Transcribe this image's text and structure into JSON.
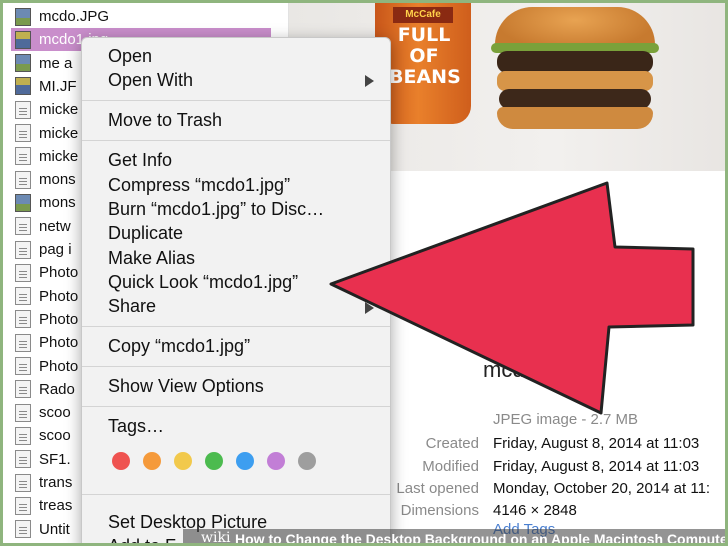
{
  "files": [
    {
      "name": "mcdo.JPG",
      "icon": "image-file-icon"
    },
    {
      "name": "mcdo1.jpg",
      "icon": "image-file-icon",
      "selected": true
    },
    {
      "name": "me a",
      "icon": "image-file-icon"
    },
    {
      "name": "MI.JF",
      "icon": "image-file-icon"
    },
    {
      "name": "micke",
      "icon": "document-icon"
    },
    {
      "name": "micke",
      "icon": "document-icon"
    },
    {
      "name": "micke",
      "icon": "document-icon"
    },
    {
      "name": "mons",
      "icon": "document-icon"
    },
    {
      "name": "mons",
      "icon": "image-file-icon"
    },
    {
      "name": "netw",
      "icon": "document-icon"
    },
    {
      "name": "pag i",
      "icon": "document-icon"
    },
    {
      "name": "Photo",
      "icon": "document-icon"
    },
    {
      "name": "Photo",
      "icon": "document-icon"
    },
    {
      "name": "Photo",
      "icon": "document-icon"
    },
    {
      "name": "Photo",
      "icon": "document-icon"
    },
    {
      "name": "Photo",
      "icon": "document-icon"
    },
    {
      "name": "Rado",
      "icon": "document-icon"
    },
    {
      "name": "scoo",
      "icon": "document-icon"
    },
    {
      "name": "scoo",
      "icon": "document-icon"
    },
    {
      "name": "SF1.",
      "icon": "document-icon"
    },
    {
      "name": "trans",
      "icon": "document-icon"
    },
    {
      "name": "treas",
      "icon": "document-icon"
    },
    {
      "name": "Untit",
      "icon": "document-icon"
    }
  ],
  "photo": {
    "cup_logo": "McCafe",
    "cup_text": "FULL OF BEANS"
  },
  "menu": {
    "open": "Open",
    "open_with": "Open With",
    "move_to_trash": "Move to Trash",
    "get_info": "Get Info",
    "compress": "Compress “mcdo1.jpg”",
    "burn": "Burn “mcdo1.jpg” to Disc…",
    "duplicate": "Duplicate",
    "make_alias": "Make Alias",
    "quick_look": "Quick Look “mcdo1.jpg”",
    "share": "Share",
    "copy": "Copy “mcdo1.jpg”",
    "show_view_options": "Show View Options",
    "tags": "Tags…",
    "set_desktop_picture": "Set Desktop Picture",
    "add_to": "Add to F"
  },
  "tag_colors": [
    "#ef5350",
    "#f59a3b",
    "#f2c94c",
    "#4cbb4f",
    "#3d9ef0",
    "#c27ed6",
    "#9e9e9e"
  ],
  "info": {
    "name": "mcdo1.jpg",
    "kind": "JPEG image - 2.7 MB",
    "created_label": "Created",
    "created": "Friday, August 8, 2014 at 11:03",
    "modified_label": "Modified",
    "modified": "Friday, August 8, 2014 at 11:03",
    "last_opened_label": "Last opened",
    "last_opened": "Monday, October 20, 2014 at 11:",
    "dimensions_label": "Dimensions",
    "dimensions": "4146 × 2848",
    "add_tags": "Add Tags"
  },
  "banner": {
    "wiki": "wiki",
    "text": "How to Change the Desktop Background on an Apple Macintosh Computer"
  },
  "colors": {
    "arrow": "#e8304f",
    "selection": "#c98ecb"
  }
}
